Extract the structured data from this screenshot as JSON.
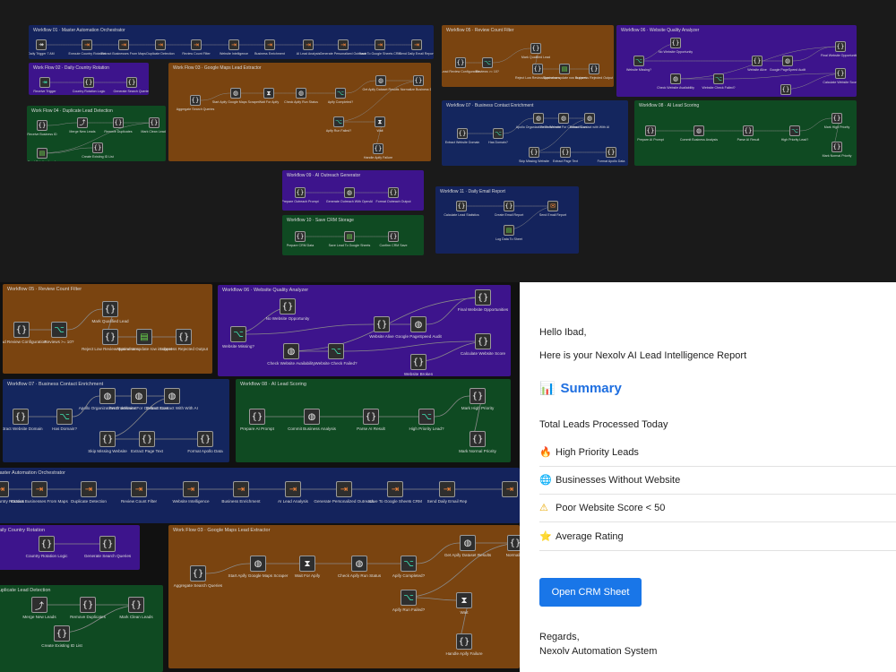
{
  "top": {
    "g1": {
      "title": "Workflow 01 · Master Automation Orchestrator",
      "nodes": [
        "Daily Trigger 7 AM",
        "Execute Country Rotation",
        "Extract Businesses From Maps",
        "Duplicate Detection",
        "Review Count Filter",
        "Website Intelligence",
        "Business Enrichment",
        "AI Lead Analysis",
        "Generate Personalized Outreach",
        "Save To Google Sheets CRM",
        "Send Daily Email Report"
      ]
    },
    "g2": {
      "title": "Work Flow 02 · Daily Country Rotation",
      "nodes": [
        "Receive Trigger",
        "Country Rotation Logic",
        "Generate Search Queries"
      ]
    },
    "g3": {
      "title": "Work Flow 03 · Google Maps Lead Extractor",
      "nodes": [
        "Aggregate Search Queries",
        "Start Apify Google Maps Scraper",
        "Wait For Apify",
        "Check Apify Run Status",
        "Apify Completed?",
        "Get Apify Dataset Results",
        "Normalize Business Data",
        "Apify Run Failed?",
        "Wait",
        "Handle Apify Failure"
      ]
    },
    "g4": {
      "title": "Work Flow 04 · Duplicate Lead Detection",
      "nodes": [
        "Receive Business ID",
        "Merge New Leads",
        "Remove Duplicates",
        "Mark Clean Leads",
        "Read Existing Leads",
        "Create Existing ID List"
      ]
    },
    "g5": {
      "title": "Workflow 05 · Review Count Filter",
      "nodes": [
        "Lead Review Configuration",
        "Reviews >= 10?",
        "Mark Qualified Lead",
        "Reject Low Review Businesses",
        "Append or update row in sheet",
        "Suppress Rejected Output"
      ]
    },
    "g6": {
      "title": "Workflow 06 · Website Quality Analyzer",
      "nodes": [
        "No Website Opportunity",
        "Website Missing?",
        "Website Alive",
        "Google PageSpeed Audit",
        "Final Website Opportunities",
        "Check Website Availability",
        "Website Check Failed?",
        "Calculate Website Score",
        "Website Broken"
      ]
    },
    "g7": {
      "title": "Workflow 07 · Business Contact Enrichment",
      "nodes": [
        "Extract Website Domain",
        "Has Domain?",
        "Apollo Organization Enrichment",
        "Fetch Website For Contact Scan",
        "Extract Contact with With AI",
        "Skip Missing Website",
        "Extract Page Text",
        "Format Apollo Data"
      ]
    },
    "g8": {
      "title": "Workflow 08 · AI Lead Scoring",
      "nodes": [
        "Prepare AI Prompt",
        "Commit Business Analysis",
        "Parse AI Result",
        "High Priority Lead?",
        "Mark High Priority",
        "Mark Normal Priority"
      ]
    },
    "g9": {
      "title": "Workflow 09 · AI Outreach Generator",
      "nodes": [
        "Prepare Outreach Prompt",
        "Generate Outreach With OpenAI",
        "Format Outreach Output"
      ]
    },
    "g10": {
      "title": "Workflow 10 · Save CRM Storage",
      "nodes": [
        "Prepare CRM Data",
        "Save Lead To Google Sheets",
        "Confirm CRM Save"
      ]
    },
    "g11": {
      "title": "Workflow 11 · Daily Email Report",
      "nodes": [
        "Calculate Lead Statistics",
        "Create Email Report",
        "Send Email Report",
        "Log Data To Sheet"
      ]
    }
  },
  "bottom": {
    "g5": {
      "title": "Workflow 05 · Review Count Filter",
      "nodes": [
        "Lead Review Configuration",
        "Reviews >= 10?",
        "Mark Qualified Lead",
        "Reject Low Review Businesses",
        "Append or update row in sheet",
        "Suppress Rejected Output"
      ]
    },
    "g6": {
      "title": "Workflow 06 · Website Quality Analyzer",
      "nodes": [
        "No Website Opportunity",
        "Website Missing?",
        "Website Alive",
        "Google PageSpeed Audit",
        "Final Website Opportunities",
        "Check Website Availability",
        "Website Check Failed?",
        "Calculate Website Score",
        "Website Broken"
      ]
    },
    "g7": {
      "title": "Workflow 07 · Business Contact Enrichment",
      "nodes": [
        "Extract Website Domain",
        "Has Domain?",
        "Apollo Organization Enrichment",
        "Fetch Website For Contact Scan",
        "Extract Contact With With AI",
        "Skip Missing Website",
        "Extract Page Text",
        "Format Apollo Data"
      ]
    },
    "g8": {
      "title": "Workflow 08 · AI Lead Scoring",
      "nodes": [
        "Prepare AI Prompt",
        "Commit Business Analysis",
        "Parse AI Result",
        "High Priority Lead?",
        "Mark High Priority",
        "Mark Normal Priority"
      ]
    },
    "g1": {
      "title": "Master Automation Orchestrator",
      "nodes": [
        "Execute Country Rotation",
        "Extract Businesses From Maps",
        "Duplicate Detection",
        "Review Count Filter",
        "Website Intelligence",
        "Business Enrichment",
        "AI Lead Analysis",
        "Generate Personalized Outreach",
        "Save To Google Sheets CRM",
        "Send Daily Email Rep"
      ]
    },
    "g2": {
      "title": "Daily Country Rotation",
      "nodes": [
        "Country Rotation Logic",
        "Generate Search Queries"
      ]
    },
    "g3": {
      "title": "Work Flow 03 · Google Maps Lead Extractor",
      "nodes": [
        "Aggregate Search Queries",
        "Start Apify Google Maps Scraper",
        "Wait For Apify",
        "Check Apify Run Status",
        "Apify Completed?",
        "Get Apify Dataset Results",
        "Normalize",
        "Apify Run Failed?",
        "Wait",
        "Handle Apify Failure"
      ]
    },
    "g4": {
      "title": "Duplicate Lead Detection",
      "nodes": [
        "Merge New Leads",
        "Remove Duplicates",
        "Mark Clean Leads",
        "Create Existing ID List"
      ]
    }
  },
  "email": {
    "greeting": "Hello Ibad,",
    "intro": "Here is your Nexolv AI Lead Intelligence Report",
    "summary_icon": "📊",
    "summary_title": "Summary",
    "total_label": "Total Leads Processed Today",
    "rows": [
      {
        "icon": "🔥",
        "label": "High Priority Leads"
      },
      {
        "icon": "🌐",
        "label": "Businesses Without Website"
      },
      {
        "icon": "⚠",
        "label": "Poor Website Score < 50"
      },
      {
        "icon": "⭐",
        "label": "Average Rating"
      }
    ],
    "button": "Open CRM Sheet",
    "regards": "Regards,",
    "signature": "Nexolv Automation System"
  }
}
